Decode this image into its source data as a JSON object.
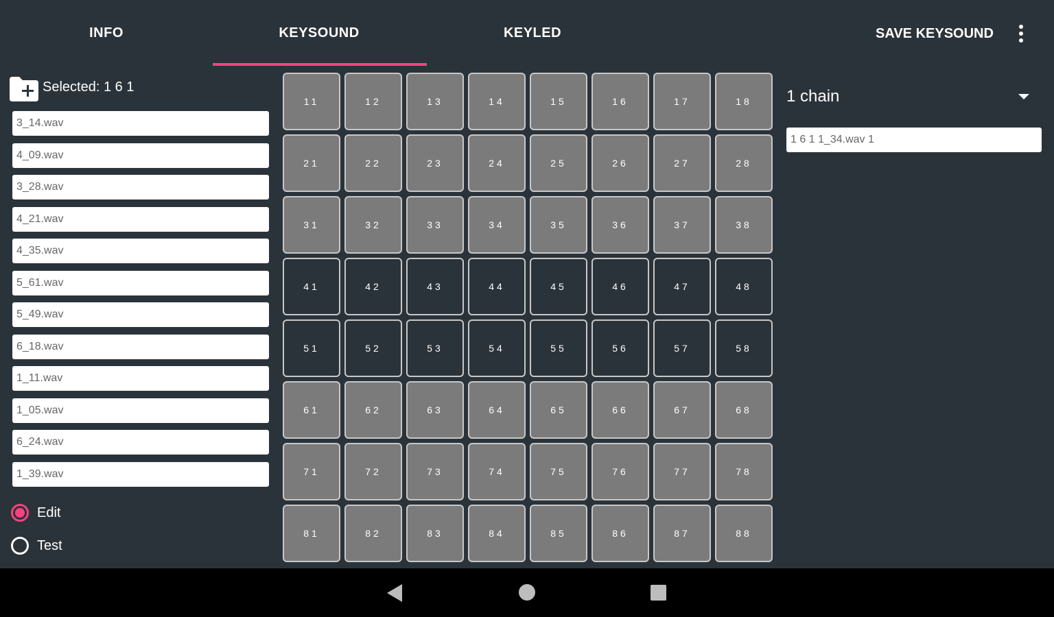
{
  "tabs": {
    "info": "INFO",
    "keysound": "KEYSOUND",
    "keyled": "KEYLED"
  },
  "toolbar": {
    "save_label": "SAVE KEYSOUND"
  },
  "left_panel": {
    "selected_label": "Selected: 1 6 1",
    "files": [
      "3_14.wav",
      "4_09.wav",
      "3_28.wav",
      "4_21.wav",
      "4_35.wav",
      "5_61.wav",
      "5_49.wav",
      "6_18.wav",
      "1_11.wav",
      "1_05.wav",
      "6_24.wav",
      "1_39.wav"
    ],
    "modes": [
      {
        "label": "Edit",
        "selected": true
      },
      {
        "label": "Test",
        "selected": false
      }
    ]
  },
  "pads": {
    "rows": [
      [
        "11",
        "12",
        "13",
        "14",
        "15",
        "16",
        "17",
        "18"
      ],
      [
        "21",
        "22",
        "23",
        "24",
        "25",
        "26",
        "27",
        "28"
      ],
      [
        "31",
        "32",
        "33",
        "34",
        "35",
        "36",
        "37",
        "38"
      ],
      [
        "41",
        "42",
        "43",
        "44",
        "45",
        "46",
        "47",
        "48"
      ],
      [
        "51",
        "52",
        "53",
        "54",
        "55",
        "56",
        "57",
        "58"
      ],
      [
        "61",
        "62",
        "63",
        "64",
        "65",
        "66",
        "67",
        "68"
      ],
      [
        "71",
        "72",
        "73",
        "74",
        "75",
        "76",
        "77",
        "78"
      ],
      [
        "81",
        "82",
        "83",
        "84",
        "85",
        "86",
        "87",
        "88"
      ]
    ],
    "dark_rows": [
      3,
      4
    ],
    "pad_color": "#7b7b7b",
    "dark_pad_color": "#2b333a"
  },
  "right_panel": {
    "chain_label": "1 chain",
    "sound_item": "1 6 1 1_34.wav 1"
  },
  "colors": {
    "background": "#2b333a",
    "accent": "#ff4081"
  }
}
